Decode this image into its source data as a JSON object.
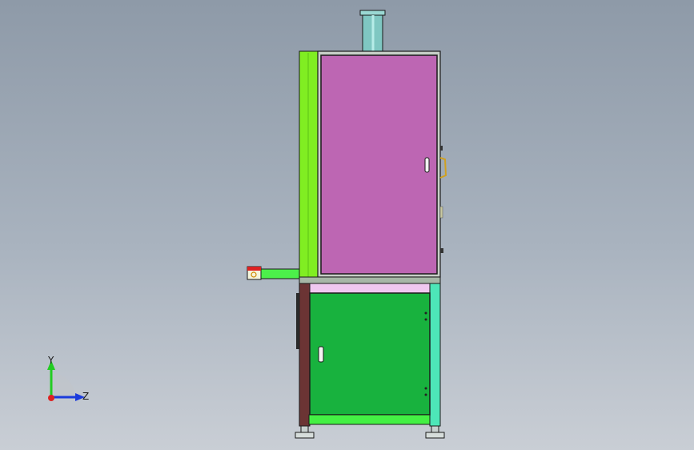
{
  "viewport": {
    "background_top": "#8e9aa8",
    "background_bottom": "#c9ced5"
  },
  "model": {
    "colors": {
      "upper_door": "#bd66b3",
      "upper_frame_post": "#80ee22",
      "lower_door": "#18b23e",
      "lower_frame": "#44f044",
      "right_leg": "#4de6b8",
      "left_leg": "#6b3434",
      "crossbar": "#f0c8f0",
      "chimney": "#7fc7c2",
      "outline": "#1a1a1a"
    }
  },
  "triad": {
    "y_label": "Y",
    "z_label": "Z",
    "y_color": "#22cc22",
    "z_color": "#1b3bdc",
    "x_color": "#dd2222"
  }
}
